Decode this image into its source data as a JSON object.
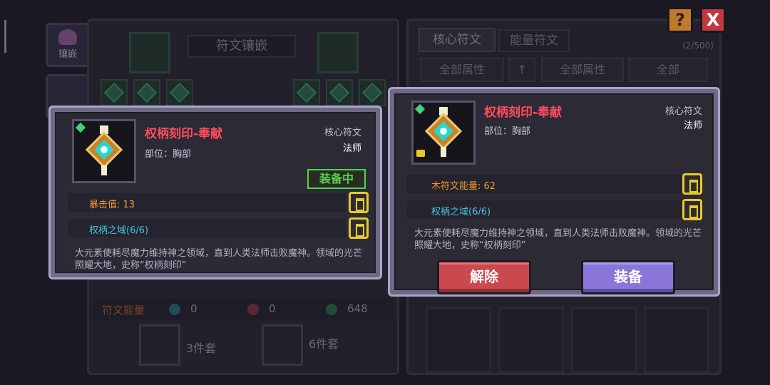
{
  "left_panel": {
    "side_tab_inlay_label": "镶嵌",
    "title": "符文镶嵌",
    "energy_label": "符文能量",
    "energy_values": [
      "0",
      "0",
      "648"
    ],
    "set_3": "3件套",
    "set_6": "6件套"
  },
  "right_panel": {
    "tabs": [
      "核心符文",
      "能量符文"
    ],
    "count": "(2/500)",
    "filters": {
      "all_attr_1": "全部属性",
      "all_attr_2": "全部属性",
      "all": "全部"
    }
  },
  "top_buttons": {
    "help": "?",
    "close": "X"
  },
  "card_left": {
    "name": "权柄刻印-奉献",
    "type": "核心符文",
    "class": "法师",
    "slot": "部位：胸部",
    "equipped": "装备中",
    "stat": "暴击值: 13",
    "set_name": "权柄之域(6/6)",
    "description": "大元素使耗尽魔力维持神之领域，直到人类法师击败魔神。领域的光芒照耀大地，史称“权柄刻印”"
  },
  "card_right": {
    "name": "权柄刻印-奉献",
    "type": "核心符文",
    "class": "法师",
    "slot": "部位：胸部",
    "stat": "木符文能量: 62",
    "set_name": "权柄之域(6/6)",
    "description": "大元素使耗尽魔力维持神之领域，直到人类法师击败魔神。领域的光芒照耀大地，史称“权柄刻印”",
    "unequip_button": "解除",
    "equip_button": "装备"
  },
  "colors": {
    "name_red": "#ff4c5e",
    "stat_orange": "#f39a2e",
    "set_cyan": "#46c6e4",
    "equipped_green": "#56d04a",
    "lock_yellow": "#e8c92a"
  }
}
